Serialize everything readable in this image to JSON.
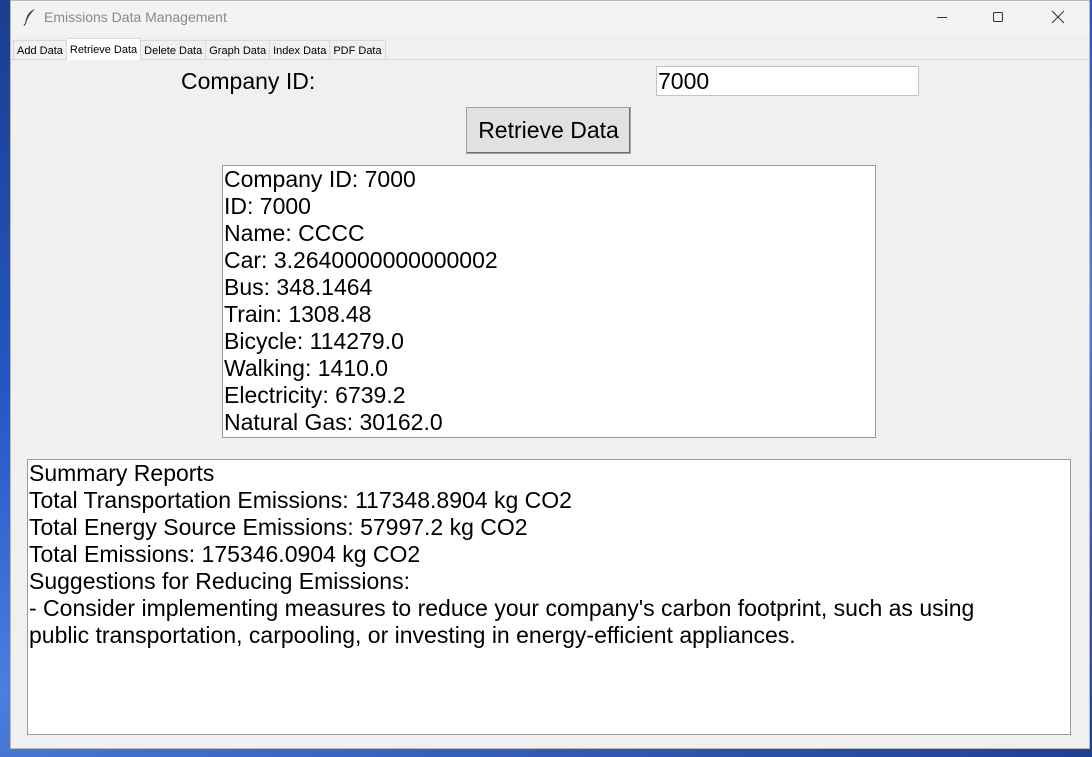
{
  "window": {
    "title": "Emissions Data Management",
    "icon": "feather-icon"
  },
  "tabs": [
    {
      "label": "Add Data",
      "active": false
    },
    {
      "label": "Retrieve Data",
      "active": true
    },
    {
      "label": "Delete Data",
      "active": false
    },
    {
      "label": "Graph Data",
      "active": false
    },
    {
      "label": "Index Data",
      "active": false
    },
    {
      "label": "PDF Data",
      "active": false
    }
  ],
  "form": {
    "company_label": "Company ID:",
    "company_value": "7000",
    "retrieve_button": "Retrieve Data"
  },
  "result": {
    "lines": [
      "Company ID: 7000",
      "ID: 7000",
      "Name: CCCC",
      "Car: 3.2640000000000002",
      "Bus: 348.1464",
      "Train: 1308.48",
      "Bicycle: 114279.0",
      "Walking: 1410.0",
      "Electricity: 6739.2",
      "Natural Gas: 30162.0"
    ]
  },
  "summary": {
    "lines": [
      "Summary Reports",
      "Total Transportation Emissions: 117348.8904 kg CO2",
      "Total Energy Source Emissions: 57997.2 kg CO2",
      "Total Emissions: 175346.0904 kg CO2",
      "Suggestions for Reducing Emissions:",
      "- Consider implementing measures to reduce your company's carbon footprint, such as using",
      "public transportation, carpooling, or investing in energy-efficient appliances."
    ]
  }
}
